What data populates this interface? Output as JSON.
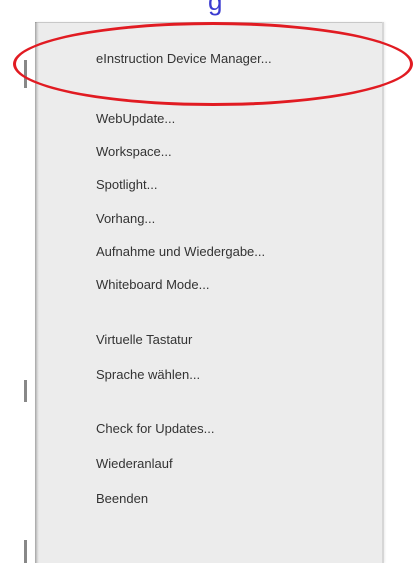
{
  "top_fragment": "g",
  "menu": {
    "items": [
      {
        "label": "eInstruction Device Manager..."
      },
      {
        "label": "WebUpdate..."
      },
      {
        "label": "Workspace..."
      },
      {
        "label": "Spotlight..."
      },
      {
        "label": "Vorhang..."
      },
      {
        "label": "Aufnahme und Wiedergabe..."
      },
      {
        "label": "Whiteboard Mode..."
      },
      {
        "label": "Virtuelle Tastatur"
      },
      {
        "label": "Sprache wählen..."
      },
      {
        "label": "Check for Updates..."
      },
      {
        "label": "Wiederanlauf"
      },
      {
        "label": "Beenden"
      }
    ]
  },
  "colors": {
    "highlight": "#e11b22",
    "menu_background": "#ececec",
    "fragment_text": "#3b3bd0"
  }
}
